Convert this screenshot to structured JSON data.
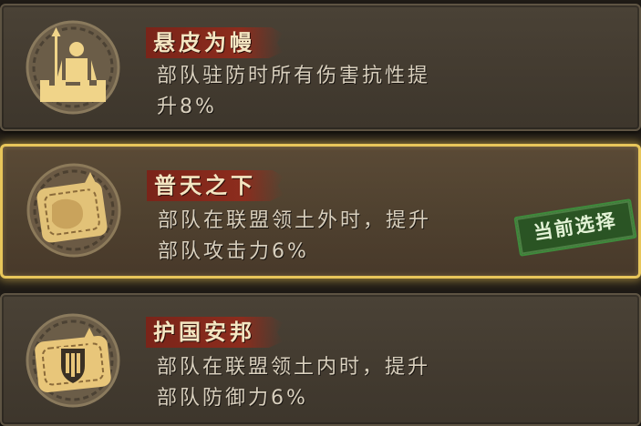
{
  "talents": [
    {
      "title": "悬皮为幔",
      "desc_line1": "部队驻防时所有伤害抗性提",
      "desc_line2": "升8%",
      "icon": "armored-soldier-icon",
      "selected": false
    },
    {
      "title": "普天之下",
      "desc_line1": "部队在联盟领土外时，提升",
      "desc_line2": "部队攻击力6%",
      "icon": "fist-spear-icon",
      "selected": true
    },
    {
      "title": "护国安邦",
      "desc_line1": "部队在联盟领土内时，提升",
      "desc_line2": "部队防御力6%",
      "icon": "shield-icon",
      "selected": false
    }
  ],
  "current_selection_label": "当前选择",
  "colors": {
    "selected_border": "#e8c65a",
    "title_banner": "#8c2c1d",
    "stamp_green": "#3f8a3c",
    "emblem_gold": "#e8c67a"
  }
}
